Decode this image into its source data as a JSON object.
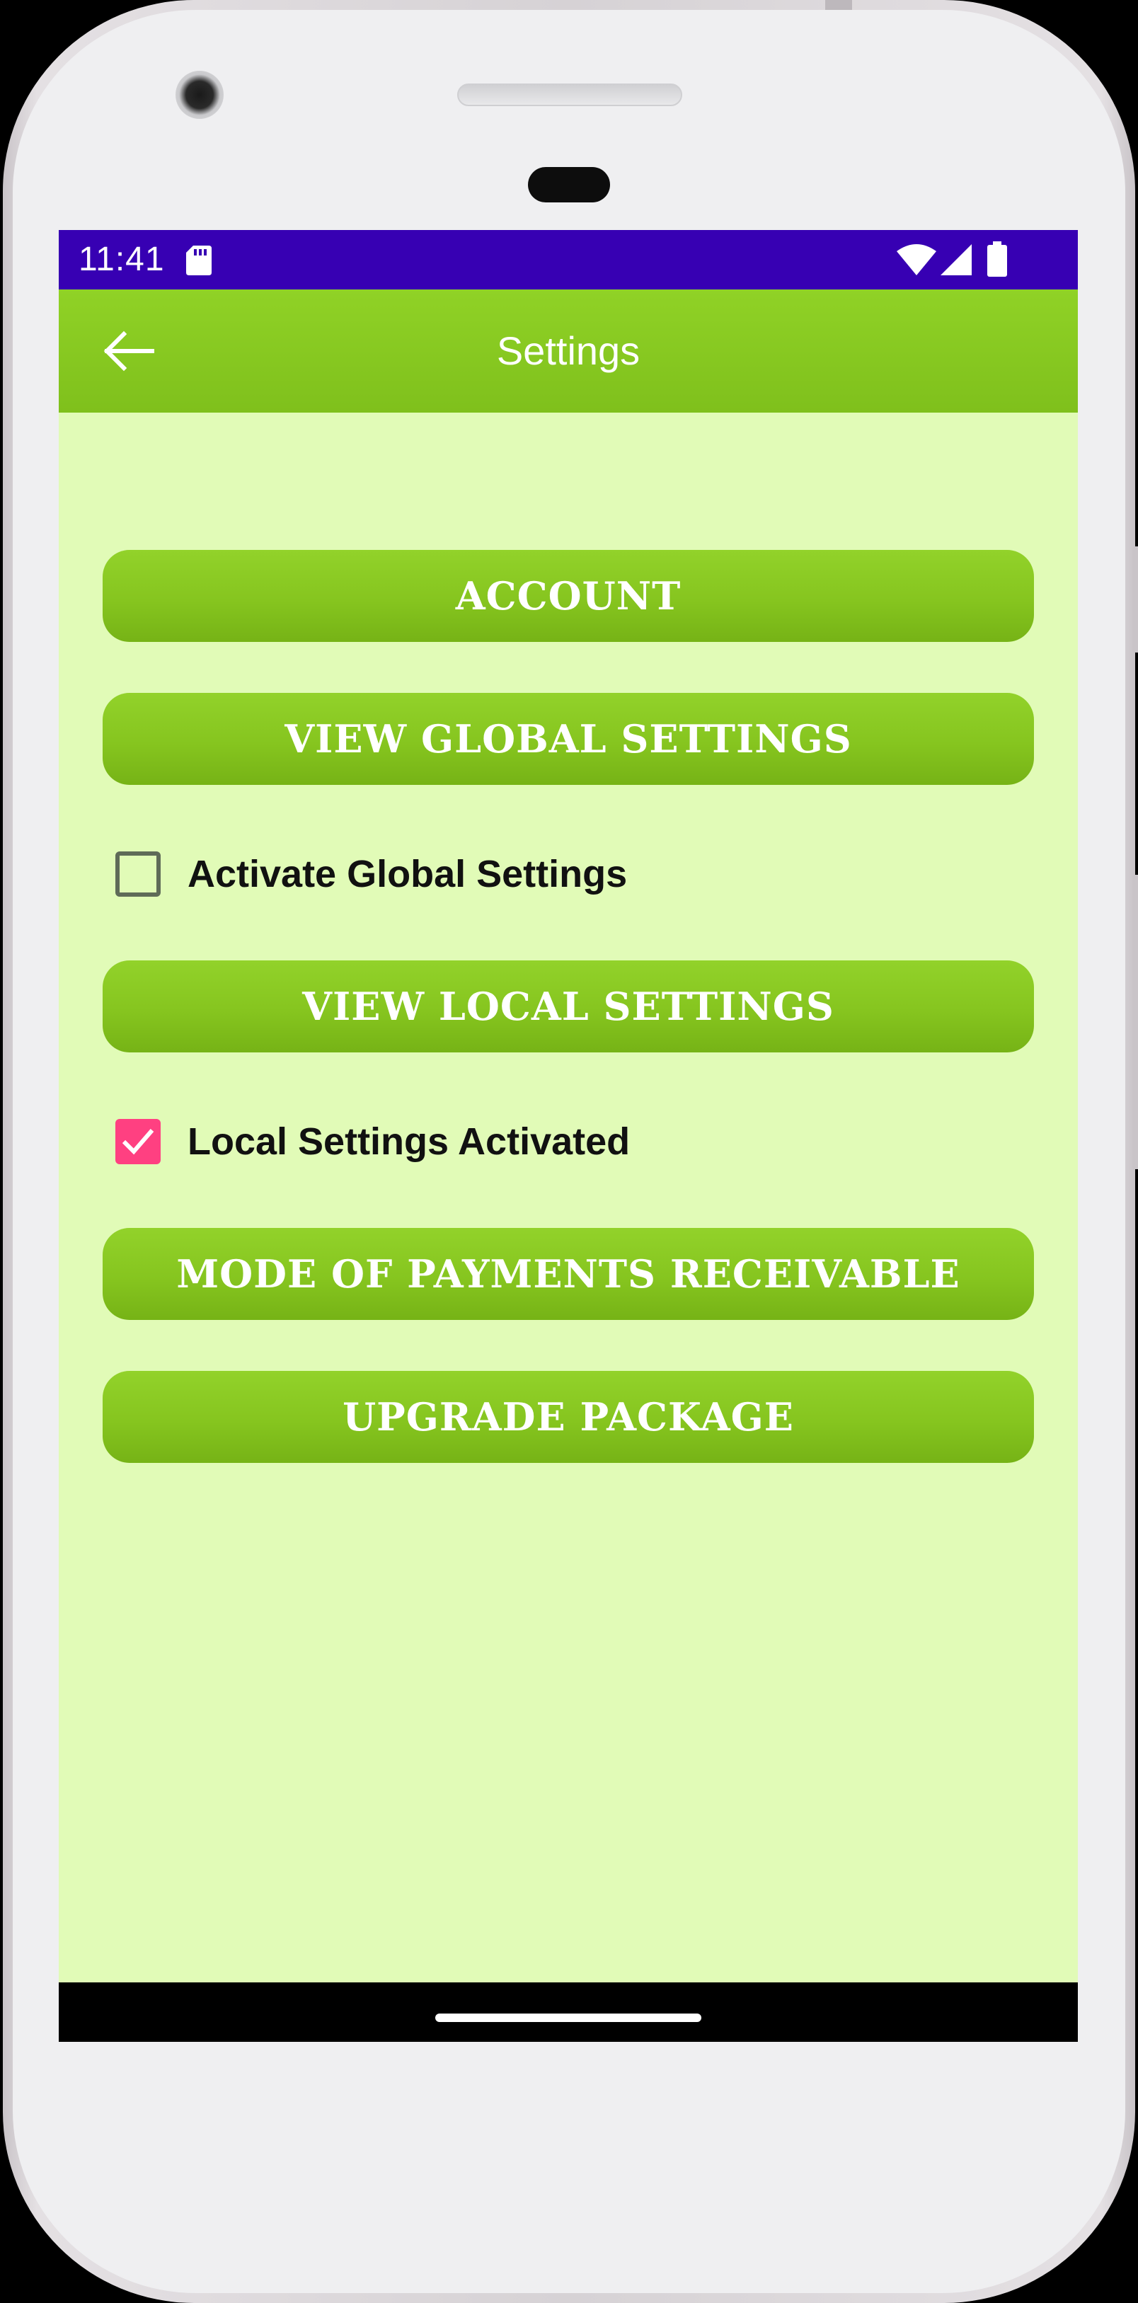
{
  "status_bar": {
    "time": "11:41"
  },
  "app_bar": {
    "title": "Settings"
  },
  "buttons": {
    "account": "ACCOUNT",
    "view_global": "VIEW GLOBAL SETTINGS",
    "view_local": "VIEW LOCAL SETTINGS",
    "payments": "MODE OF PAYMENTS RECEIVABLE",
    "upgrade": "UPGRADE PACKAGE"
  },
  "checkboxes": {
    "global": {
      "label": "Activate Global Settings",
      "checked": false
    },
    "local": {
      "label": "Local Settings Activated",
      "checked": true
    }
  },
  "colors": {
    "status_bar": "#3700b3",
    "app_bar": "#86c81e",
    "button": "#86c51f",
    "background": "#e1fbb7",
    "checkbox_accent": "#ff4081"
  },
  "icons": {
    "back": "arrow-left-icon",
    "sd_card": "sd-card-icon",
    "wifi": "wifi-icon",
    "signal": "signal-icon",
    "battery": "battery-icon"
  }
}
